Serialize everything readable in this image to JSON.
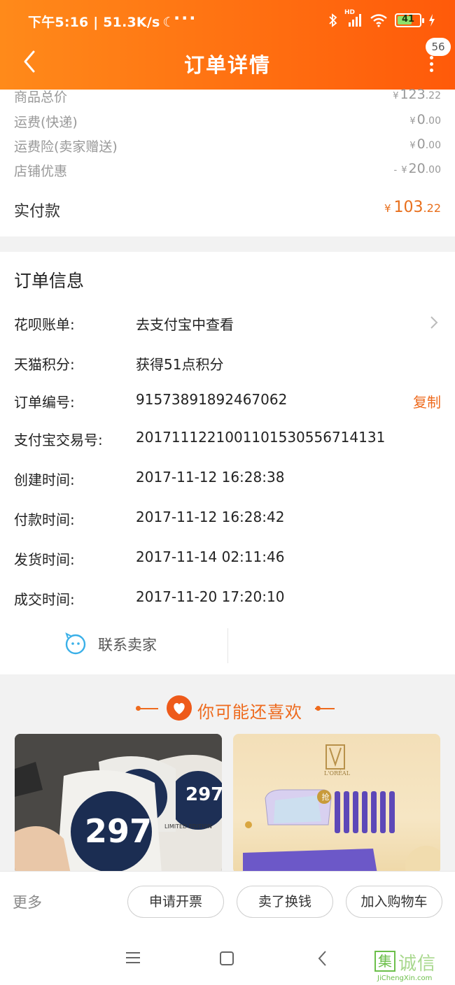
{
  "status_bar": {
    "time_speed": "下午5:16 | 51.3K/s",
    "moon": "☾",
    "dots": "···",
    "network": "HD",
    "battery": "41"
  },
  "nav": {
    "title": "订单详情",
    "badge": "56"
  },
  "price": {
    "rows": [
      {
        "label": "商品总价",
        "prefix": "",
        "currency": "¥",
        "int": "123",
        "dec": ".22"
      },
      {
        "label": "运费(快递)",
        "prefix": "",
        "currency": "¥",
        "int": "0",
        "dec": ".00"
      },
      {
        "label": "运费险(卖家赠送)",
        "prefix": "",
        "currency": "¥",
        "int": "0",
        "dec": ".00"
      },
      {
        "label": "店铺优惠",
        "prefix": "- ",
        "currency": "¥",
        "int": "20",
        "dec": ".00"
      }
    ],
    "paid_label": "实付款",
    "paid_currency": "¥",
    "paid_int": "103",
    "paid_dec": ".22"
  },
  "order_info": {
    "title": "订单信息",
    "rows": [
      {
        "label": "花呗账单:",
        "value": "去支付宝中查看"
      },
      {
        "label": "天猫积分:",
        "value": "获得51点积分"
      },
      {
        "label": "订单编号:",
        "value": "91573891892467062"
      },
      {
        "label": "支付宝交易号:",
        "value": "2017111221001101530556714131"
      },
      {
        "label": "创建时间:",
        "value": "2017-11-12 16:28:38"
      },
      {
        "label": "付款时间:",
        "value": "2017-11-12 16:28:42"
      },
      {
        "label": "发货时间:",
        "value": "2017-11-14 02:11:46"
      },
      {
        "label": "成交时间:",
        "value": "2017-11-20 17:20:10"
      }
    ],
    "copy_label": "复制",
    "contact_label": "联系卖家"
  },
  "recommend": {
    "title": "你可能还喜欢",
    "product_a_text": "297",
    "product_a_caption": "LIMITED EDITION",
    "product_b_brand": "L'ORÉAL",
    "product_b_tag": "抢"
  },
  "actions": {
    "more": "更多",
    "invoice": "申请开票",
    "resell": "卖了换钱",
    "add_cart": "加入购物车"
  },
  "watermark": {
    "box": "集",
    "text": "诚信",
    "url": "JiChengXin.com"
  },
  "colors": {
    "brand_orange": "#ff6a0e",
    "accent_text": "#ee6a1d"
  }
}
